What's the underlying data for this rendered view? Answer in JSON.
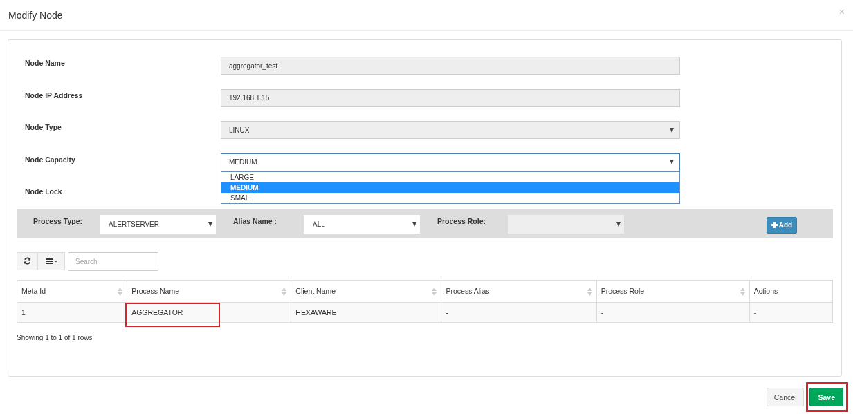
{
  "window": {
    "title": "Modify Node",
    "close": "×"
  },
  "fields": [
    {
      "label": "Node Name",
      "kind": "text",
      "value": "aggregator_test",
      "disabled": true
    },
    {
      "label": "Node IP Address",
      "kind": "text",
      "value": "192.168.1.15",
      "disabled": true
    },
    {
      "label": "Node Type",
      "kind": "select",
      "value": "LINUX",
      "disabled": true
    },
    {
      "label": "Node Capacity",
      "kind": "select",
      "value": "MEDIUM",
      "disabled": false,
      "open": true,
      "options": [
        {
          "label": "LARGE",
          "selected": false
        },
        {
          "label": "MEDIUM",
          "selected": true
        },
        {
          "label": "SMALL",
          "selected": false
        }
      ]
    },
    {
      "label": "Node Lock",
      "kind": "hidden"
    }
  ],
  "filters": [
    {
      "label": "Process Type:",
      "value": "ALERTSERVER",
      "disabled": false
    },
    {
      "label": "Alias Name :",
      "value": "ALL",
      "disabled": false
    },
    {
      "label": "Process Role:",
      "disabled": true
    }
  ],
  "add_button": {
    "label": "Add"
  },
  "search": {
    "placeholder": "Search"
  },
  "table": {
    "columns": [
      {
        "label": "Meta Id",
        "sortable": true
      },
      {
        "label": "Process Name",
        "sortable": true
      },
      {
        "label": "Client Name",
        "sortable": true
      },
      {
        "label": "Process Alias",
        "sortable": true
      },
      {
        "label": "Process Role",
        "sortable": true
      },
      {
        "label": "Actions",
        "sortable": false
      }
    ],
    "rows": [
      {
        "cells": [
          {
            "text": "1",
            "highlighted": false
          },
          {
            "text": "AGGREGATOR",
            "highlighted": true
          },
          {
            "text": "HEXAWARE",
            "highlighted": false
          },
          {
            "text": "-",
            "highlighted": false
          },
          {
            "text": "-",
            "highlighted": false
          },
          {
            "text": "-",
            "highlighted": false
          }
        ]
      }
    ]
  },
  "pagination_text": "Showing 1 to 1 of 1 rows",
  "buttons": [
    {
      "label": "Cancel",
      "kind": "default",
      "highlighted": false
    },
    {
      "label": "Save",
      "kind": "primary",
      "highlighted": true
    }
  ]
}
